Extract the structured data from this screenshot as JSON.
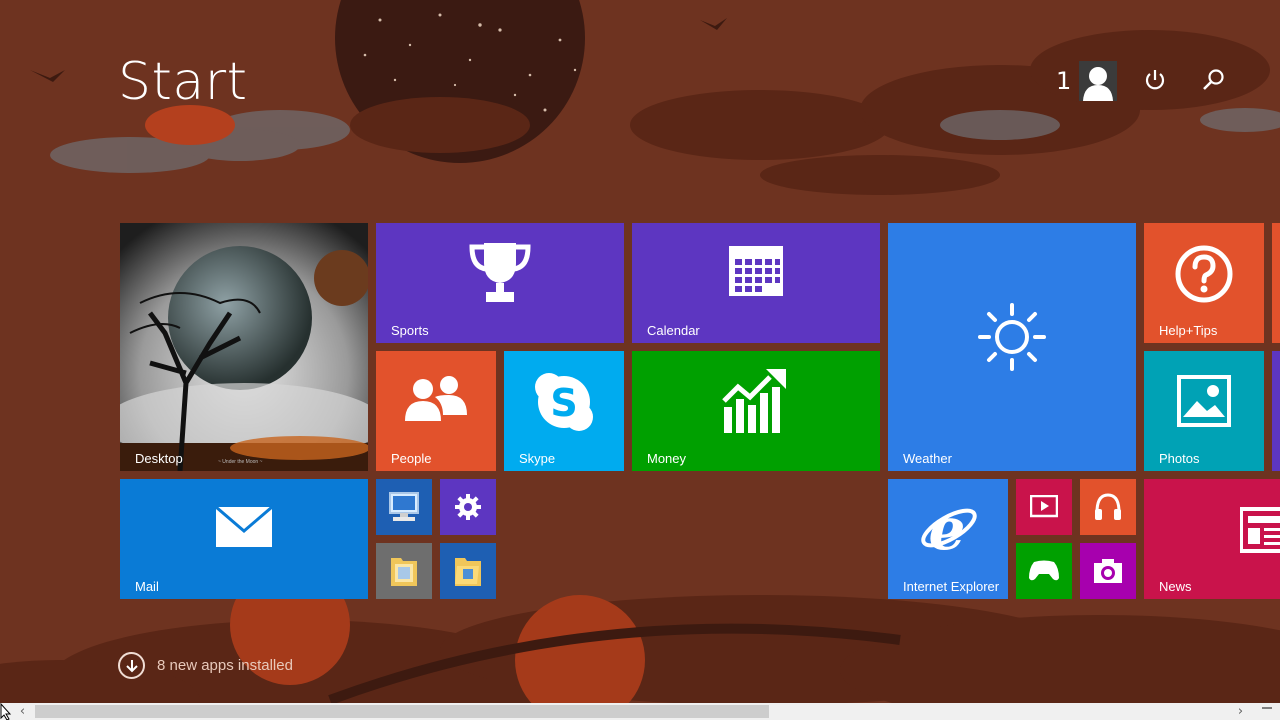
{
  "screen": {
    "title": "Start",
    "user": {
      "name": "1"
    }
  },
  "colors": {
    "background": "#6e3320",
    "purple": "#5d36c1",
    "orange": "#e2522c",
    "skype": "#00abef",
    "green": "#00a000",
    "blue": "#2d7de6",
    "teal": "#00a2b5",
    "mail": "#0a7bd6",
    "crimson": "#c9134b",
    "magenta": "#a700ae"
  },
  "tiles": {
    "desktop": {
      "label": "Desktop",
      "credit": "~ Under the Moon ~"
    },
    "sports": {
      "label": "Sports"
    },
    "calendar": {
      "label": "Calendar"
    },
    "weather": {
      "label": "Weather"
    },
    "help": {
      "label": "Help+Tips"
    },
    "people": {
      "label": "People"
    },
    "skype": {
      "label": "Skype"
    },
    "money": {
      "label": "Money"
    },
    "photos": {
      "label": "Photos"
    },
    "mail": {
      "label": "Mail"
    },
    "internet_explorer": {
      "label": "Internet Explorer"
    },
    "news": {
      "label": "News"
    }
  },
  "small_tiles": [
    "this-pc",
    "settings",
    "file-explorer",
    "documents-folder",
    "video",
    "music",
    "games",
    "camera"
  ],
  "notification": {
    "text": "8 new apps installed"
  },
  "scrollbar": {
    "left_arrow": "‹",
    "right_arrow": "›"
  }
}
